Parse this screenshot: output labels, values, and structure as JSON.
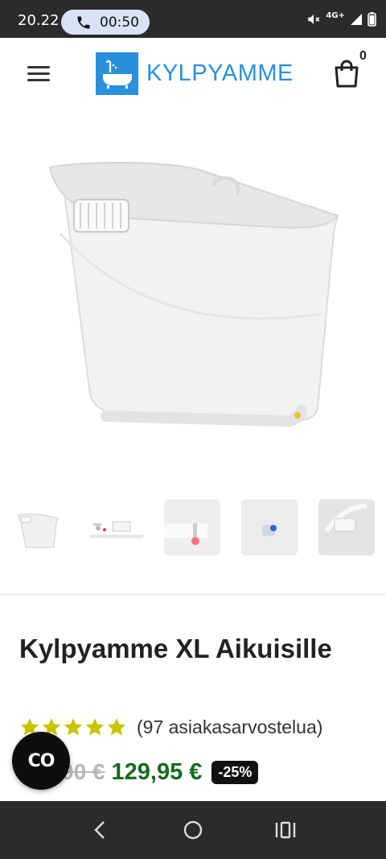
{
  "status": {
    "time": "20.22",
    "call_timer": "00:50",
    "network": "4G+"
  },
  "header": {
    "logo_text": "KYLPYAMME",
    "cart_count": "0"
  },
  "product": {
    "title": "Kylpyamme XL Aikuisille",
    "rating_stars": 5,
    "reviews": "(97 asiakasarvostelua)",
    "old_price": "90 €",
    "new_price": "129,95 €",
    "discount": "-25%"
  },
  "chat": {
    "label": "CO"
  },
  "colors": {
    "brand_blue": "#2a90dc",
    "price_green": "#176a1f",
    "star_yellow": "#c9c400",
    "bar_dark": "#2b2b2d"
  }
}
